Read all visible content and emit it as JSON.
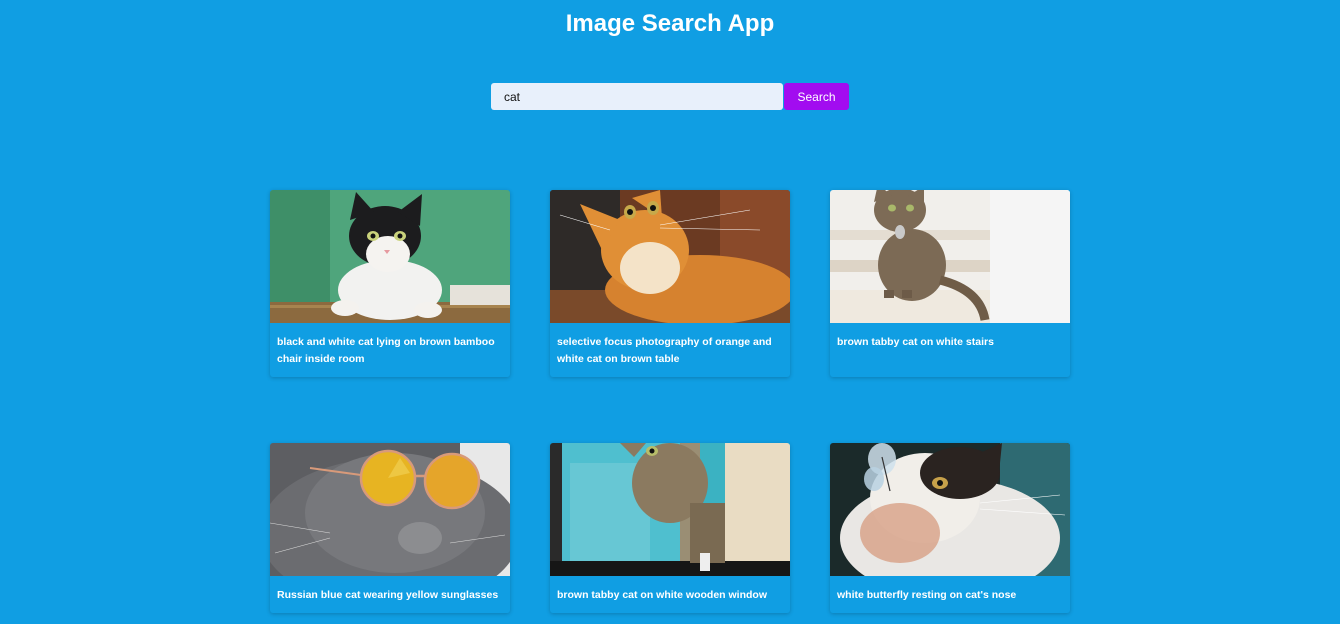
{
  "header": {
    "title": "Image Search App"
  },
  "search": {
    "value": "cat",
    "button_label": "Search"
  },
  "results": [
    {
      "caption": "black and white cat lying on brown bamboo chair inside room",
      "image": "cat-photo-black-white"
    },
    {
      "caption": "selective focus photography of orange and white cat on brown table",
      "image": "cat-photo-orange"
    },
    {
      "caption": "brown tabby cat on white stairs",
      "image": "cat-photo-tabby-stairs"
    },
    {
      "caption": "Russian blue cat wearing yellow sunglasses",
      "image": "cat-photo-sunglasses"
    },
    {
      "caption": "brown tabby cat on white wooden window",
      "image": "cat-photo-window"
    },
    {
      "caption": "white butterfly resting on cat's nose",
      "image": "cat-photo-butterfly"
    }
  ]
}
